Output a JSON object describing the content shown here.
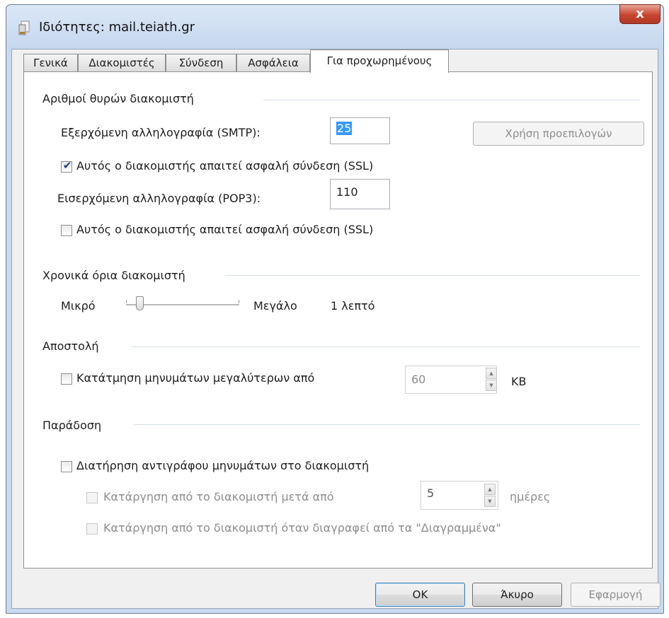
{
  "window": {
    "title": "Ιδιότητες: mail.teiath.gr",
    "close_label": "x"
  },
  "tabs": [
    {
      "label": "Γενικά"
    },
    {
      "label": "Διακομιστές"
    },
    {
      "label": "Σύνδεση"
    },
    {
      "label": "Ασφάλεια"
    },
    {
      "label": "Για προχωρημένους"
    }
  ],
  "ports": {
    "group_label": "Αριθμοί θυρών διακομιστή",
    "smtp_label": "Εξερχόμενη αλληλογραφία (SMTP):",
    "smtp_value": "25",
    "defaults_button": "Χρήση προεπιλογών",
    "smtp_ssl_label": "Αυτός ο διακομιστής απαιτεί ασφαλή σύνδεση (SSL)",
    "smtp_ssl_checked": true,
    "pop3_label": "Εισερχόμενη αλληλογραφία (POP3):",
    "pop3_value": "110",
    "pop3_ssl_label": "Αυτός ο διακομιστής απαιτεί ασφαλή σύνδεση (SSL)",
    "pop3_ssl_checked": false
  },
  "timeouts": {
    "group_label": "Χρονικά όρια διακομιστή",
    "min_label": "Μικρό",
    "max_label": "Μεγάλο",
    "value_label": "1 λεπτό",
    "slider_fraction": 0.12
  },
  "sending": {
    "group_label": "Αποστολή",
    "split_label": "Κατάτμηση μηνυμάτων μεγαλύτερων από",
    "split_checked": false,
    "split_value": "60",
    "unit": "KB"
  },
  "delivery": {
    "group_label": "Παράδοση",
    "keep_copy_label": "Διατήρηση αντιγράφου μηνυμάτων στο διακομιστή",
    "keep_copy_checked": false,
    "remove_after_label": "Κατάργηση από το διακομιστή μετά από",
    "remove_after_value": "5",
    "days_label": "ημέρες",
    "remove_deleted_label": "Κατάργηση από το διακομιστή όταν διαγραφεί από τα \"Διαγραμμένα\""
  },
  "buttons": {
    "ok": "OK",
    "cancel": "Άκυρο",
    "apply": "Εφαρμογή"
  }
}
